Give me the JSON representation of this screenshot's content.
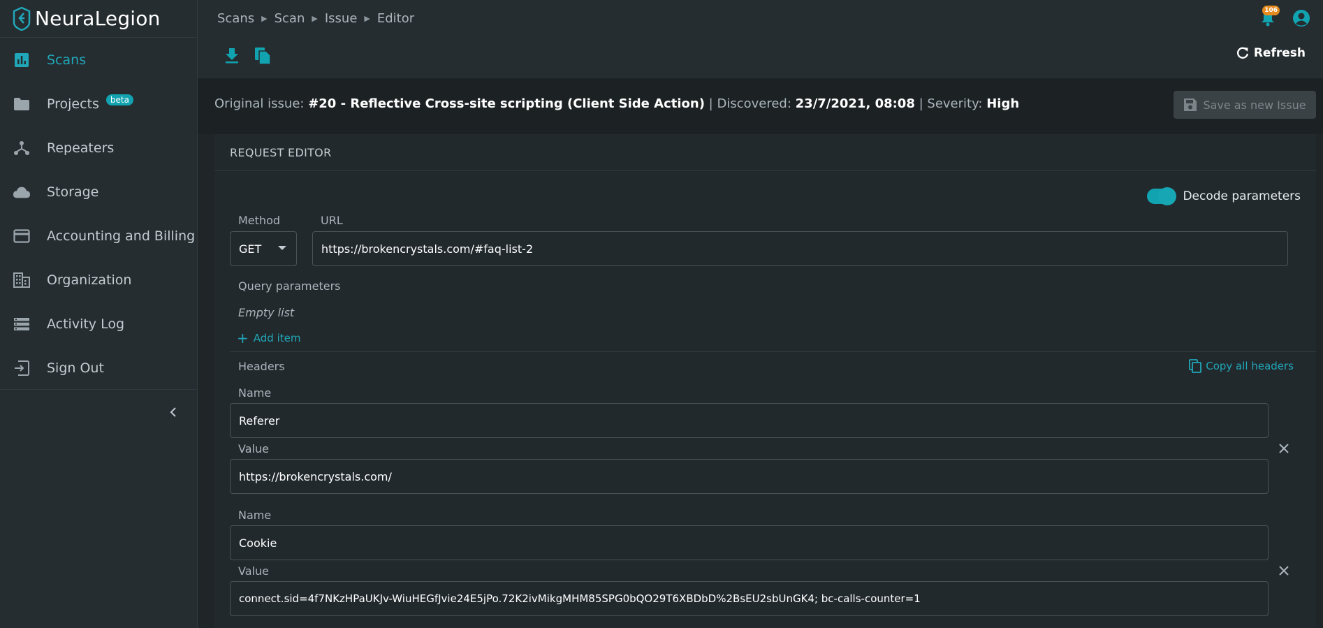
{
  "brand": {
    "name": "NeuraLegion",
    "logo_icon": "neuralegion-logo-icon"
  },
  "colors": {
    "accent": "#20a7b8",
    "sidebar_bg": "#262d31",
    "page_bg": "#202528",
    "badge_orange": "#e68a1e"
  },
  "sidebar": {
    "items": [
      {
        "label": "Scans",
        "icon": "chart-icon",
        "active": true
      },
      {
        "label": "Projects",
        "icon": "folder-icon",
        "badge": "beta"
      },
      {
        "label": "Repeaters",
        "icon": "network-icon"
      },
      {
        "label": "Storage",
        "icon": "cloud-icon"
      },
      {
        "label": "Accounting and Billing",
        "icon": "credit-card-icon"
      },
      {
        "label": "Organization",
        "icon": "building-icon"
      },
      {
        "label": "Activity Log",
        "icon": "list-icon"
      },
      {
        "label": "Sign Out",
        "icon": "sign-out-icon"
      }
    ]
  },
  "breadcrumb": [
    "Scans",
    "Scan",
    "Issue",
    "Editor"
  ],
  "notifications": {
    "count": "106"
  },
  "toolbar": {
    "refresh_label": "Refresh"
  },
  "issue": {
    "original_label": "Original issue:",
    "title": "#20 - Reflective Cross-site scripting (Client Side Action)",
    "discovered_label": "| Discovered:",
    "discovered": "23/7/2021, 08:08",
    "severity_label": "| Severity:",
    "severity": "High",
    "save_label": "Save as new Issue"
  },
  "editor": {
    "title": "REQUEST EDITOR",
    "decode_label": "Decode parameters",
    "decode_on": true,
    "method_label": "Method",
    "method": "GET",
    "url_label": "URL",
    "url": "https://brokencrystals.com/#faq-list-2",
    "query_label": "Query parameters",
    "query_empty": "Empty list",
    "add_item": "Add item",
    "headers_label": "Headers",
    "copy_headers": "Copy all headers",
    "headers": [
      {
        "name_label": "Name",
        "name": "Referer",
        "value_label": "Value",
        "value": "https://brokencrystals.com/"
      },
      {
        "name_label": "Name",
        "name": "Cookie",
        "value_label": "Value",
        "value": "connect.sid=4f7NKzHPaUKJv-WiuHEGfJvie24E5jPo.72K2ivMikgMHM85SPG0bQO29T6XBDbD%2BsEU2sbUnGK4; bc-calls-counter=1"
      }
    ]
  }
}
